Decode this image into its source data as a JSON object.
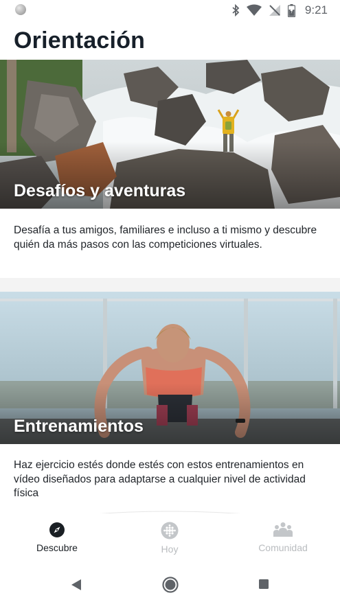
{
  "status_bar": {
    "time": "9:21"
  },
  "page": {
    "title": "Orientación"
  },
  "cards": [
    {
      "title": "Desafíos y aventuras",
      "description": "Desafía a tus amigos, familiares e incluso a ti mismo y descubre quién da más pasos con las competiciones virtuales."
    },
    {
      "title": "Entrenamientos",
      "description": "Haz ejercicio estés donde estés con estos entrenamientos en vídeo diseñados para adaptarse a cualquier nivel de actividad física"
    }
  ],
  "tabs": [
    {
      "label": "Descubre",
      "icon": "compass-icon",
      "active": true
    },
    {
      "label": "Hoy",
      "icon": "dots-grid-icon",
      "active": false
    },
    {
      "label": "Comunidad",
      "icon": "community-icon",
      "active": false
    }
  ],
  "colors": {
    "active_tab": "#1a1f24",
    "inactive_tab": "#b9bcbf",
    "title": "#17202a"
  }
}
